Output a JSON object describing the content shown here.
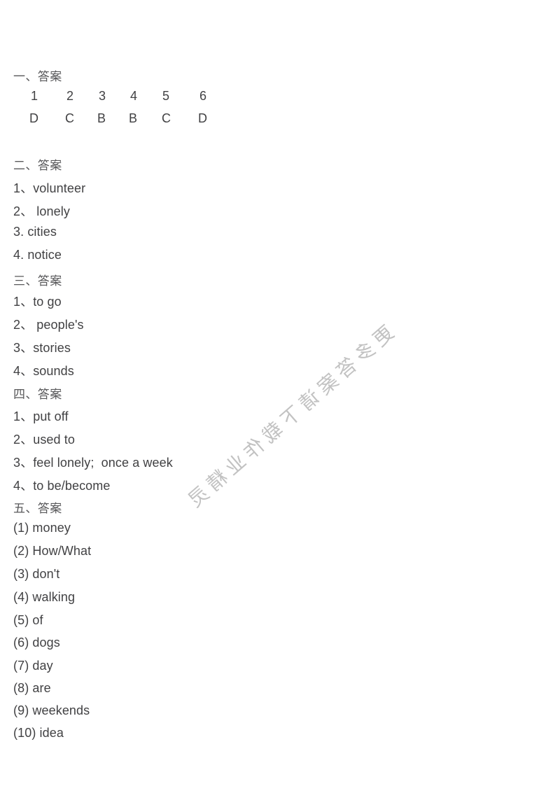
{
  "document": {
    "background_color": "#ffffff",
    "text_color": "#414143",
    "heading_color": "#58585a",
    "watermark_color": "#c2c2c2"
  },
  "watermark": {
    "text": "更多答案请下载作业精灵"
  },
  "sections": [
    {
      "id": "section-one",
      "heading": "一、答案",
      "type": "grid",
      "question_numbers": [
        "1",
        "2",
        "3",
        "4",
        "5",
        "6"
      ],
      "answers": [
        "D",
        "C",
        "B",
        "B",
        "C",
        "D"
      ],
      "column_x": [
        44,
        95,
        141,
        186,
        232,
        285
      ]
    },
    {
      "id": "section-two",
      "heading": "二、答案",
      "type": "list",
      "items": [
        "1、volunteer",
        "2、 lonely",
        "3. cities",
        "4. notice"
      ]
    },
    {
      "id": "section-three",
      "heading": "三、答案",
      "type": "list",
      "items": [
        "1、to go",
        "2、 people's",
        "3、stories",
        "4、sounds"
      ]
    },
    {
      "id": "section-four",
      "heading": "四、答案",
      "type": "list",
      "items": [
        "1、put off",
        "2、used to",
        "3、feel lonely;  once a week",
        "4、to be/become"
      ]
    },
    {
      "id": "section-five",
      "heading": "五、答案",
      "type": "list",
      "items": [
        "(1) money",
        "(2) How/What",
        "(3) don't",
        "(4) walking",
        "(5) of",
        "(6) dogs",
        "(7) day",
        "(8) are",
        "(9) weekends",
        "(10) idea"
      ]
    }
  ],
  "layout": {
    "line_positions": {
      "s1_heading": 95,
      "s1_numbers": 127,
      "s1_answers": 159,
      "s2_heading": 222,
      "s2_items": [
        255,
        288,
        321,
        354
      ],
      "s3_heading": 387,
      "s3_items": [
        417,
        450,
        483,
        516
      ],
      "s4_heading": 549,
      "s4_items": [
        581,
        614,
        647,
        680
      ],
      "s5_heading": 712,
      "s5_items": [
        744,
        777,
        810,
        843,
        876,
        908,
        941,
        973,
        1005,
        1037
      ]
    }
  }
}
